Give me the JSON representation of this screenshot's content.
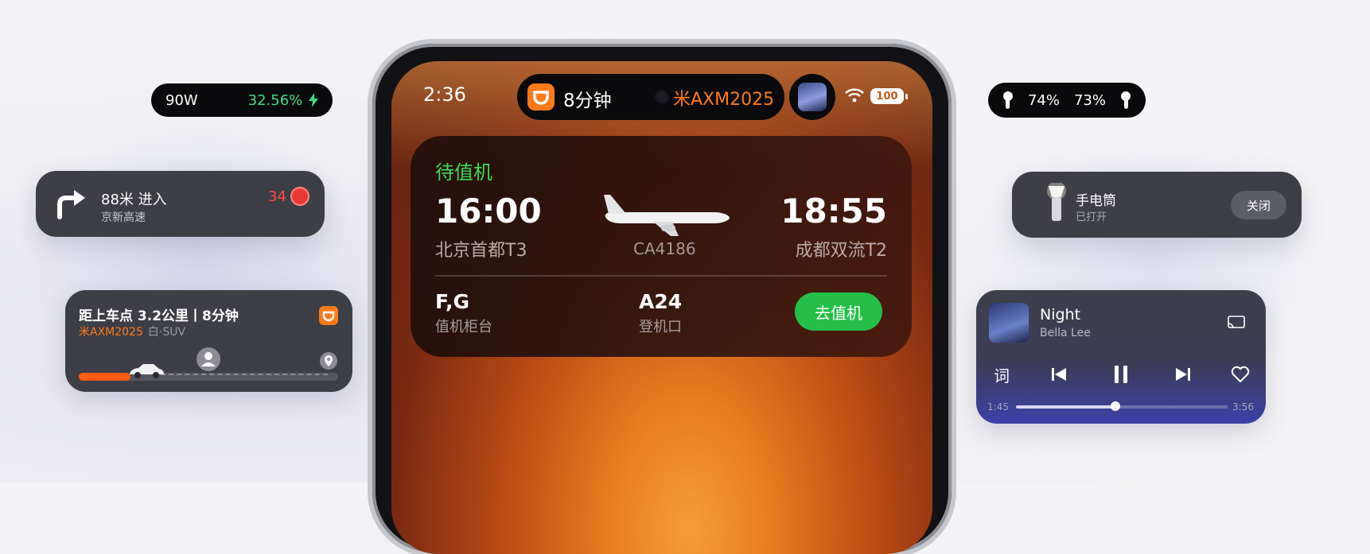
{
  "charging": {
    "watt": "90W",
    "percent": "32.56%"
  },
  "airpods": {
    "left_pct": "74%",
    "right_pct": "73%"
  },
  "navigation": {
    "instruction": "88米 进入",
    "road": "京新高速",
    "speed_limit": "34"
  },
  "ride": {
    "summary": "距上车点 3.2公里丨8分钟",
    "plate": "米AXM2025",
    "car_desc": "白·SUV",
    "progress": 0.2
  },
  "flashlight": {
    "title": "手电筒",
    "status": "已打开",
    "button": "关闭"
  },
  "music": {
    "title": "Night",
    "artist": "Bella Lee",
    "lyrics_label": "词",
    "time_current": "1:45",
    "time_total": "3:56",
    "progress": 0.47
  },
  "phone": {
    "clock": "2:36",
    "island": {
      "minutes": "8分钟",
      "plate": "米AXM2025"
    },
    "battery": "100"
  },
  "flight": {
    "status": "待值机",
    "departure_time": "16:00",
    "departure_airport": "北京首都T3",
    "arrival_time": "18:55",
    "arrival_airport": "成都双流T2",
    "flight_number": "CA4186",
    "counter": "F,G",
    "counter_label": "值机柜台",
    "gate": "A24",
    "gate_label": "登机口",
    "checkin_button": "去值机"
  },
  "colors": {
    "accent_orange": "#ff7a1a",
    "status_green": "#3ddc54",
    "alert_red": "#ff4a3d"
  }
}
